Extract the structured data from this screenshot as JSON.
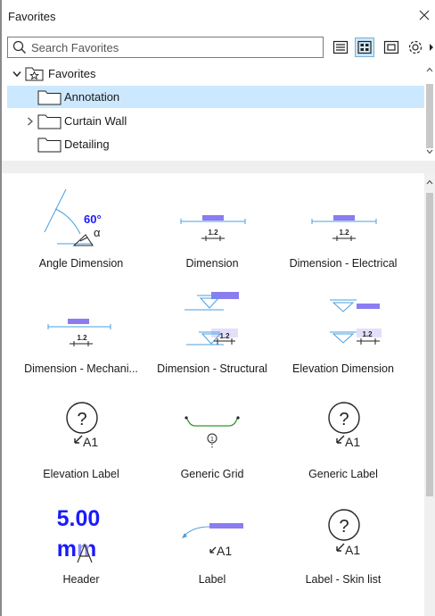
{
  "window": {
    "title": "Favorites"
  },
  "search": {
    "placeholder": "Search Favorites"
  },
  "tree": {
    "items": [
      {
        "label": "Favorites",
        "expanded": true
      },
      {
        "label": "Annotation",
        "selected": true
      },
      {
        "label": "Curtain Wall",
        "collapsed": true
      },
      {
        "label": "Detailing"
      }
    ]
  },
  "items": [
    {
      "label": "Angle Dimension",
      "angle_text": "60°",
      "alpha_text": "α"
    },
    {
      "label": "Dimension",
      "num_text": "1.2"
    },
    {
      "label": "Dimension - Electrical",
      "num_text": "1.2"
    },
    {
      "label": "Dimension - Mechani...",
      "num_text": "1.2"
    },
    {
      "label": "Dimension - Structural",
      "num_text": "1.2"
    },
    {
      "label": "Elevation Dimension",
      "num_text": "1.2"
    },
    {
      "label": "Elevation Label",
      "q_text": "?",
      "tag_text": "A1"
    },
    {
      "label": "Generic Grid",
      "marker_text": "1"
    },
    {
      "label": "Generic Label",
      "q_text": "?",
      "tag_text": "A1"
    },
    {
      "label": "Header",
      "big_text": "5.00",
      "unit_text": "mm"
    },
    {
      "label": "Label",
      "tag_text": "A1"
    },
    {
      "label": "Label -  Skin list",
      "q_text": "?",
      "tag_text": "A1"
    }
  ],
  "colors": {
    "accent": "#1a1aff",
    "dimension_line": "#3ea3e6",
    "tag_fill": "#8b7cf0",
    "selection": "#cce8ff"
  }
}
